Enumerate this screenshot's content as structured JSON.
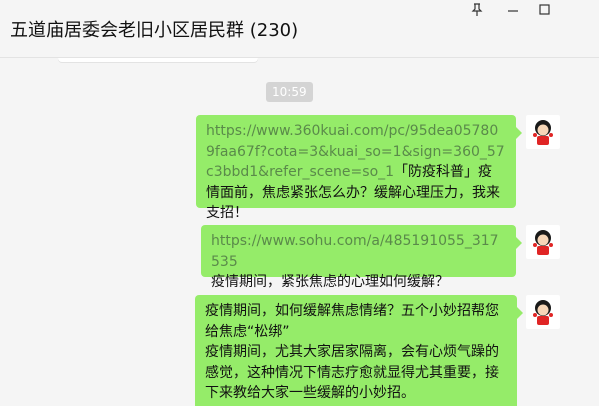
{
  "window": {
    "title": "五道庙居委会老旧小区居民群 (230)",
    "pin_icon": "pin-icon",
    "minimize_icon": "minimize-icon",
    "maximize_icon": "maximize-icon"
  },
  "chat": {
    "timestamp": "10:59",
    "messages": [
      {
        "link": "https://www.360kuai.com/pc/95dea057809faa67f?cota=3&kuai_so=1&sign=360_57c3bbd1&refer_scene=so_1",
        "text": "「防疫科普」疫情面前，焦虑紧张怎么办？缓解心理压力，我来支招！"
      },
      {
        "link": "https://www.sohu.com/a/485191055_317535",
        "text": "疫情期间，紧张焦虑的心理如何缓解？"
      },
      {
        "text": "疫情期间，如何缓解焦虑情绪？五个小妙招帮您给焦虑“松绑”\n疫情期间，尤其大家居家隔离，会有心烦气躁的感觉，这种情况下情志疗愈就显得尤其重要，接下来教给大家一些缓解的小妙招。"
      }
    ]
  },
  "colors": {
    "bubble_green": "#95ec69",
    "link_green": "#5a8a4a",
    "background": "#f5f5f5"
  }
}
